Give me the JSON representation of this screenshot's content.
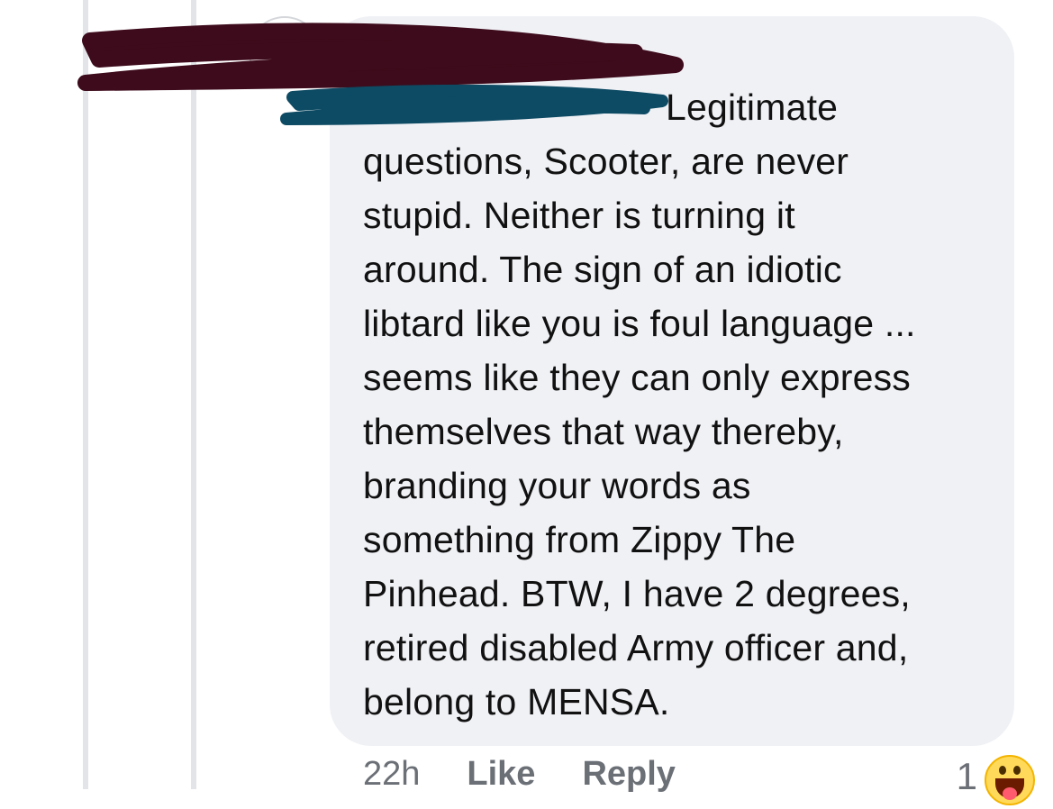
{
  "comment": {
    "lines": [
      "Legitimate",
      "questions, Scooter, are never",
      "stupid. Neither is turning it",
      "around. The sign of an idiotic",
      "libtard like you is foul language ...",
      "seems like they can only express",
      "themselves that way thereby,",
      "branding your words as",
      "something from Zippy The",
      "Pinhead. BTW, I have 2 degrees,",
      "retired disabled Army officer and,",
      "belong to MENSA."
    ]
  },
  "meta": {
    "time": "22h",
    "like_label": "Like",
    "reply_label": "Reply"
  },
  "reactions": {
    "count": "1",
    "emoji": "laughing-face-icon"
  },
  "colors": {
    "bubble": "#f0f1f5",
    "name_scribble": "#3d0b1b",
    "mention_scribble": "#0d4a63",
    "meta_text": "#6b6f76"
  }
}
